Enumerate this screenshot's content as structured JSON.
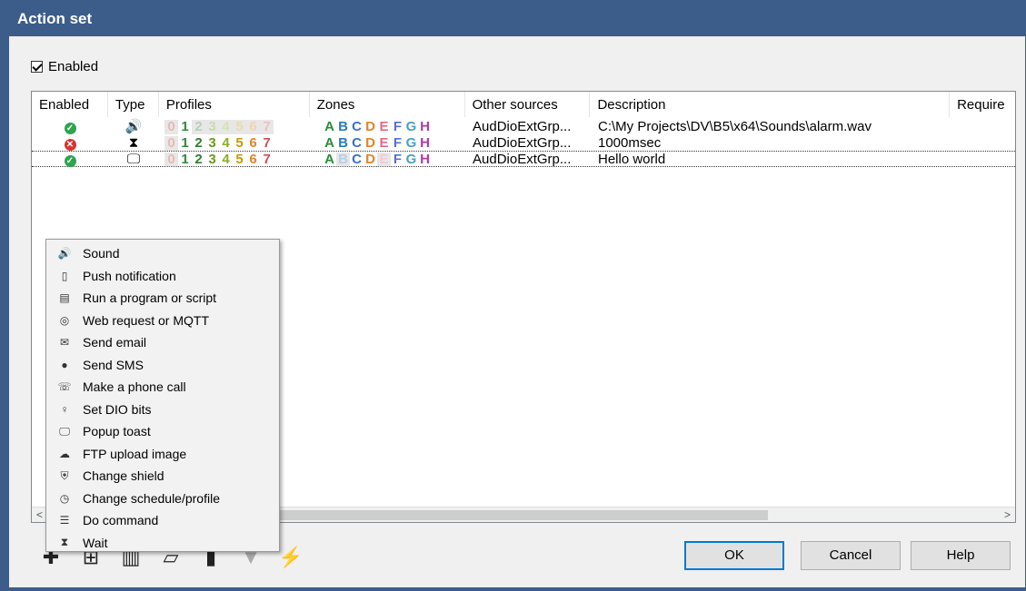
{
  "window": {
    "title": "Action set"
  },
  "enabled_checkbox": {
    "label": "Enabled",
    "checked": true
  },
  "list": {
    "columns": [
      "Enabled",
      "Type",
      "Profiles",
      "Zones",
      "Other sources",
      "Description",
      "Require"
    ],
    "rows": [
      {
        "enabled": "ok",
        "type_icon": "speaker-icon",
        "type_glyph": "🔊",
        "profiles": [
          "0",
          "1",
          "2",
          "3",
          "4",
          "5",
          "6",
          "7"
        ],
        "profiles_active": [
          false,
          true,
          false,
          false,
          false,
          false,
          false,
          false
        ],
        "zones": [
          "A",
          "B",
          "C",
          "D",
          "E",
          "F",
          "G",
          "H"
        ],
        "zones_active": [
          true,
          true,
          true,
          true,
          true,
          true,
          true,
          true
        ],
        "other_sources": "AudDioExtGrp...",
        "description": "C:\\My Projects\\DV\\B5\\x64\\Sounds\\alarm.wav"
      },
      {
        "enabled": "no",
        "type_icon": "hourglass-icon",
        "type_glyph": "⧗",
        "profiles": [
          "0",
          "1",
          "2",
          "3",
          "4",
          "5",
          "6",
          "7"
        ],
        "profiles_active": [
          false,
          true,
          true,
          true,
          true,
          true,
          true,
          true
        ],
        "zones": [
          "A",
          "B",
          "C",
          "D",
          "E",
          "F",
          "G",
          "H"
        ],
        "zones_active": [
          true,
          true,
          true,
          true,
          true,
          true,
          true,
          true
        ],
        "other_sources": "AudDioExtGrp...",
        "description": "1000msec"
      },
      {
        "enabled": "ok",
        "type_icon": "monitor-icon",
        "type_glyph": "🖵",
        "profiles": [
          "0",
          "1",
          "2",
          "3",
          "4",
          "5",
          "6",
          "7"
        ],
        "profiles_active": [
          false,
          true,
          true,
          true,
          true,
          true,
          true,
          true
        ],
        "zones": [
          "A",
          "B",
          "C",
          "D",
          "E",
          "F",
          "G",
          "H"
        ],
        "zones_active": [
          true,
          false,
          true,
          true,
          false,
          true,
          true,
          true
        ],
        "other_sources": "AudDioExtGrp...",
        "description": "Hello world"
      }
    ]
  },
  "colors": {
    "digits": [
      "#c0392b",
      "#2e8b3a",
      "#2e7d32",
      "#6a9a1f",
      "#8ab020",
      "#c69a00",
      "#e0842a",
      "#c85050"
    ],
    "zones": [
      "#2e8b3a",
      "#2a7bc0",
      "#3b6fd0",
      "#e0842a",
      "#e06a8a",
      "#5a6fd0",
      "#4aa0c0",
      "#b03aa0"
    ],
    "title_bar": "#3c5d8a",
    "ok_border": "#0078d7"
  },
  "menu": {
    "items": [
      {
        "label": "Sound",
        "icon": "speaker-icon",
        "glyph": "🔊"
      },
      {
        "label": "Push notification",
        "icon": "phone-icon",
        "glyph": "▯"
      },
      {
        "label": "Run a program or script",
        "icon": "script-icon",
        "glyph": "▤"
      },
      {
        "label": "Web request or MQTT",
        "icon": "globe-icon",
        "glyph": "◎"
      },
      {
        "label": "Send email",
        "icon": "envelope-icon",
        "glyph": "✉"
      },
      {
        "label": "Send SMS",
        "icon": "chat-icon",
        "glyph": "●"
      },
      {
        "label": "Make a phone call",
        "icon": "phone-call-icon",
        "glyph": "☏"
      },
      {
        "label": "Set DIO bits",
        "icon": "bulb-icon",
        "glyph": "♀"
      },
      {
        "label": "Popup toast",
        "icon": "monitor-icon",
        "glyph": "🖵"
      },
      {
        "label": "FTP upload image",
        "icon": "cloud-icon",
        "glyph": "☁"
      },
      {
        "label": "Change shield",
        "icon": "shield-icon",
        "glyph": "⛨"
      },
      {
        "label": "Change schedule/profile",
        "icon": "clock-icon",
        "glyph": "◷"
      },
      {
        "label": "Do command",
        "icon": "list-icon",
        "glyph": "☰"
      },
      {
        "label": "Wait",
        "icon": "hourglass-icon",
        "glyph": "⧗"
      }
    ]
  },
  "toolbar": {
    "buttons": [
      {
        "name": "add-icon",
        "glyph": "✚",
        "enabled": true
      },
      {
        "name": "add-copy-icon",
        "glyph": "⊞",
        "enabled": true
      },
      {
        "name": "delete-icon",
        "glyph": "▥",
        "enabled": true
      },
      {
        "name": "edit-icon",
        "glyph": "▱",
        "enabled": true
      },
      {
        "name": "move-up-icon",
        "glyph": "▮",
        "enabled": true
      },
      {
        "name": "move-down-icon",
        "glyph": "▼",
        "enabled": false
      },
      {
        "name": "test-icon",
        "glyph": "⚡",
        "enabled": true
      }
    ]
  },
  "buttons": {
    "ok": "OK",
    "cancel": "Cancel",
    "help": "Help"
  }
}
